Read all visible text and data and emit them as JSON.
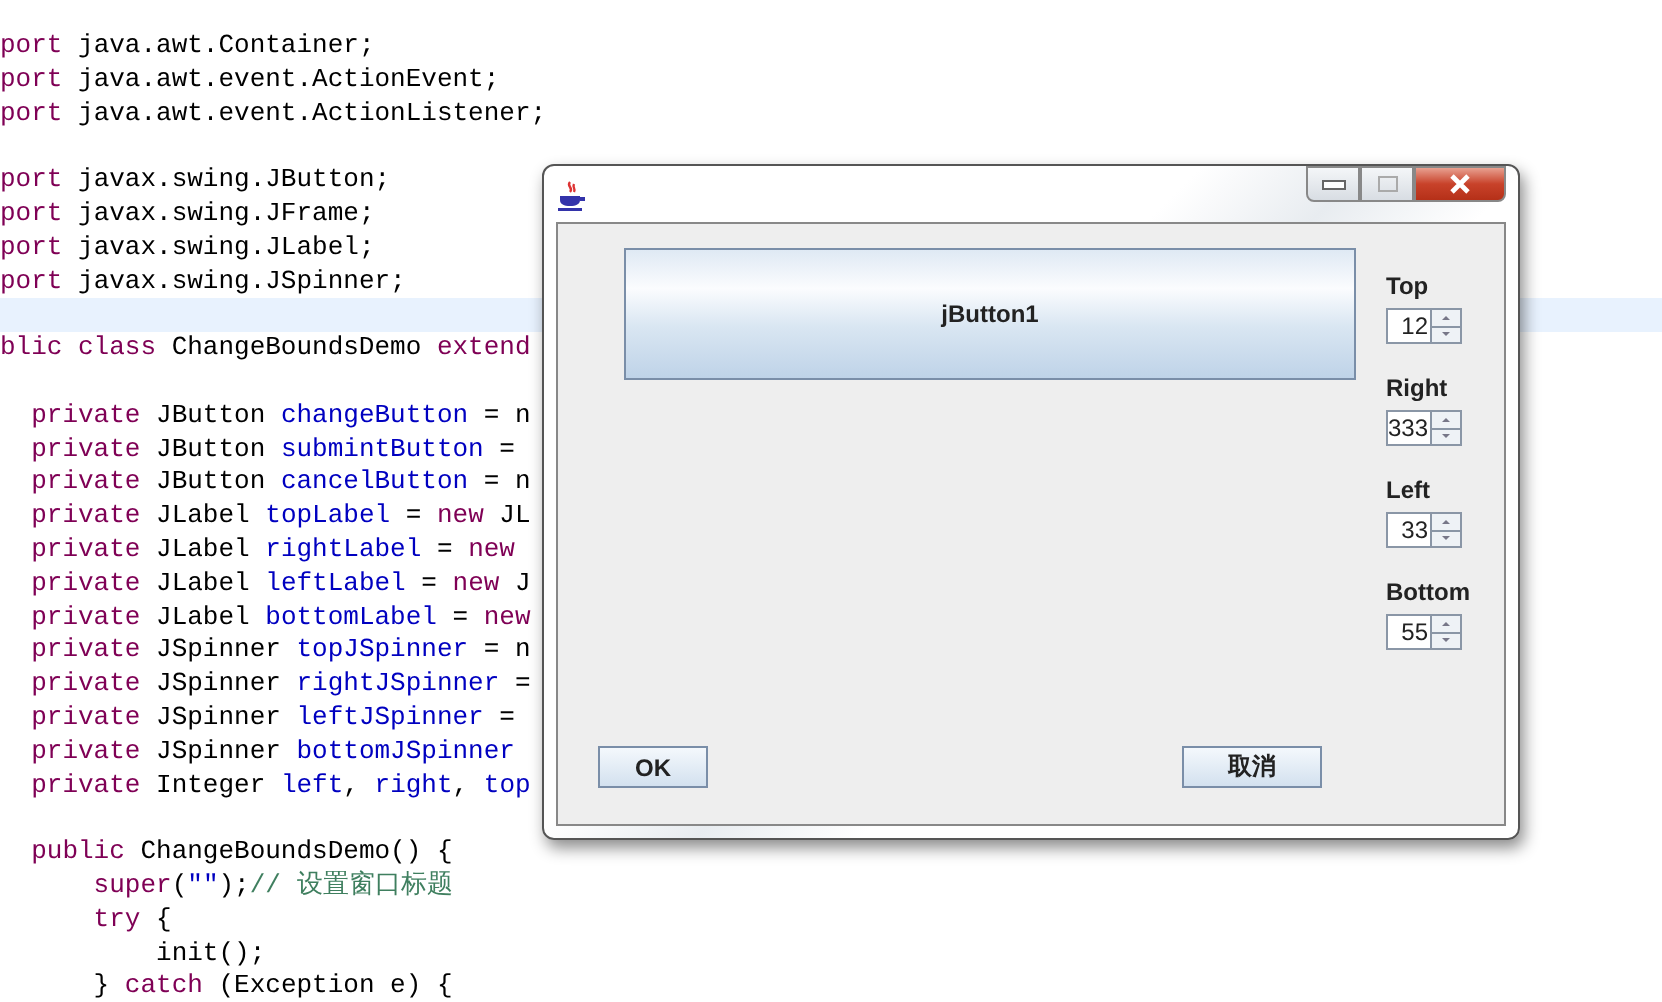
{
  "editor": {
    "lines": [
      {
        "selected": false,
        "segments": [
          {
            "text": "port",
            "kind": "keyword"
          },
          {
            "text": " java.awt.Container;",
            "kind": "plain"
          }
        ]
      },
      {
        "selected": false,
        "segments": [
          {
            "text": "port",
            "kind": "keyword"
          },
          {
            "text": " java.awt.event.ActionEvent;",
            "kind": "plain"
          }
        ]
      },
      {
        "selected": false,
        "segments": [
          {
            "text": "port",
            "kind": "keyword"
          },
          {
            "text": " java.awt.event.ActionListener;",
            "kind": "plain"
          }
        ]
      },
      {
        "selected": false
      },
      {
        "selected": false,
        "segments": [
          {
            "text": "port",
            "kind": "keyword"
          },
          {
            "text": " javax.swing.JButton;",
            "kind": "plain"
          }
        ]
      },
      {
        "selected": false,
        "segments": [
          {
            "text": "port",
            "kind": "keyword"
          },
          {
            "text": " javax.swing.JFrame;",
            "kind": "plain"
          }
        ]
      },
      {
        "selected": false,
        "segments": [
          {
            "text": "port",
            "kind": "keyword"
          },
          {
            "text": " javax.swing.JLabel;",
            "kind": "plain"
          }
        ]
      },
      {
        "selected": false,
        "segments": [
          {
            "text": "port",
            "kind": "keyword"
          },
          {
            "text": " javax.swing.JSpinner;",
            "kind": "plain"
          }
        ]
      },
      {
        "selected": true
      },
      {
        "selected": false,
        "segments": [
          {
            "text": "blic class",
            "kind": "keyword"
          },
          {
            "text": " ChangeBoundsDemo ",
            "kind": "plain"
          },
          {
            "text": "extend",
            "kind": "keyword"
          }
        ]
      },
      {
        "selected": false
      },
      {
        "selected": false,
        "segments": [
          {
            "text": "  private",
            "kind": "keyword"
          },
          {
            "text": " JButton ",
            "kind": "plain"
          },
          {
            "text": "changeButton",
            "kind": "field"
          },
          {
            "text": " = n",
            "kind": "plain"
          }
        ]
      },
      {
        "selected": false,
        "segments": [
          {
            "text": "  private",
            "kind": "keyword"
          },
          {
            "text": " JButton ",
            "kind": "plain"
          },
          {
            "text": "submintButton",
            "kind": "field"
          },
          {
            "text": " =",
            "kind": "plain"
          }
        ]
      },
      {
        "selected": false,
        "segments": [
          {
            "text": "  private",
            "kind": "keyword"
          },
          {
            "text": " JButton ",
            "kind": "plain"
          },
          {
            "text": "cancelButton",
            "kind": "field"
          },
          {
            "text": " = n",
            "kind": "plain"
          }
        ]
      },
      {
        "selected": false,
        "segments": [
          {
            "text": "  private",
            "kind": "keyword"
          },
          {
            "text": " JLabel ",
            "kind": "plain"
          },
          {
            "text": "topLabel",
            "kind": "field"
          },
          {
            "text": " = ",
            "kind": "plain"
          },
          {
            "text": "new",
            "kind": "keyword"
          },
          {
            "text": " JL",
            "kind": "plain"
          }
        ]
      },
      {
        "selected": false,
        "segments": [
          {
            "text": "  private",
            "kind": "keyword"
          },
          {
            "text": " JLabel ",
            "kind": "plain"
          },
          {
            "text": "rightLabel",
            "kind": "field"
          },
          {
            "text": " = ",
            "kind": "plain"
          },
          {
            "text": "new",
            "kind": "keyword"
          }
        ]
      },
      {
        "selected": false,
        "segments": [
          {
            "text": "  private",
            "kind": "keyword"
          },
          {
            "text": " JLabel ",
            "kind": "plain"
          },
          {
            "text": "leftLabel",
            "kind": "field"
          },
          {
            "text": " = ",
            "kind": "plain"
          },
          {
            "text": "new",
            "kind": "keyword"
          },
          {
            "text": " J",
            "kind": "plain"
          }
        ]
      },
      {
        "selected": false,
        "segments": [
          {
            "text": "  private",
            "kind": "keyword"
          },
          {
            "text": " JLabel ",
            "kind": "plain"
          },
          {
            "text": "bottomLabel",
            "kind": "field"
          },
          {
            "text": " = ",
            "kind": "plain"
          },
          {
            "text": "new",
            "kind": "keyword"
          }
        ]
      },
      {
        "selected": false,
        "segments": [
          {
            "text": "  private",
            "kind": "keyword"
          },
          {
            "text": " JSpinner ",
            "kind": "plain"
          },
          {
            "text": "topJSpinner",
            "kind": "field"
          },
          {
            "text": " = n",
            "kind": "plain"
          }
        ]
      },
      {
        "selected": false,
        "segments": [
          {
            "text": "  private",
            "kind": "keyword"
          },
          {
            "text": " JSpinner ",
            "kind": "plain"
          },
          {
            "text": "rightJSpinner",
            "kind": "field"
          },
          {
            "text": " =",
            "kind": "plain"
          }
        ]
      },
      {
        "selected": false,
        "segments": [
          {
            "text": "  private",
            "kind": "keyword"
          },
          {
            "text": " JSpinner ",
            "kind": "plain"
          },
          {
            "text": "leftJSpinner",
            "kind": "field"
          },
          {
            "text": " =",
            "kind": "plain"
          }
        ]
      },
      {
        "selected": false,
        "segments": [
          {
            "text": "  private",
            "kind": "keyword"
          },
          {
            "text": " JSpinner ",
            "kind": "plain"
          },
          {
            "text": "bottomJSpinner",
            "kind": "field"
          }
        ]
      },
      {
        "selected": false,
        "segments": [
          {
            "text": "  private",
            "kind": "keyword"
          },
          {
            "text": " Integer ",
            "kind": "plain"
          },
          {
            "text": "left",
            "kind": "field"
          },
          {
            "text": ", ",
            "kind": "plain"
          },
          {
            "text": "right",
            "kind": "field"
          },
          {
            "text": ", ",
            "kind": "plain"
          },
          {
            "text": "top",
            "kind": "field"
          }
        ]
      },
      {
        "selected": false
      },
      {
        "selected": false,
        "segments": [
          {
            "text": "  public",
            "kind": "keyword"
          },
          {
            "text": " ChangeBoundsDemo() {",
            "kind": "plain"
          }
        ]
      },
      {
        "selected": false,
        "segments": [
          {
            "text": "      super",
            "kind": "keyword"
          },
          {
            "text": "(",
            "kind": "plain"
          },
          {
            "text": "\"\"",
            "kind": "field"
          },
          {
            "text": ");",
            "kind": "plain"
          },
          {
            "text": "// 设置窗口标题",
            "kind": "comment"
          }
        ]
      },
      {
        "selected": false,
        "segments": [
          {
            "text": "      try",
            "kind": "keyword"
          },
          {
            "text": " {",
            "kind": "plain"
          }
        ]
      },
      {
        "selected": false,
        "segments": [
          {
            "text": "          init();",
            "kind": "plain"
          }
        ]
      },
      {
        "selected": false,
        "segments": [
          {
            "text": "      } ",
            "kind": "plain"
          },
          {
            "text": "catch",
            "kind": "keyword"
          },
          {
            "text": " (Exception e) {",
            "kind": "plain"
          }
        ]
      }
    ]
  },
  "window": {
    "button": "jButton1",
    "spinners": [
      {
        "label": "Top",
        "value": "12"
      },
      {
        "label": "Right",
        "value": "333"
      },
      {
        "label": "Left",
        "value": "33"
      },
      {
        "label": "Bottom",
        "value": "55"
      }
    ],
    "ok": "OK",
    "cancel": "取消"
  }
}
